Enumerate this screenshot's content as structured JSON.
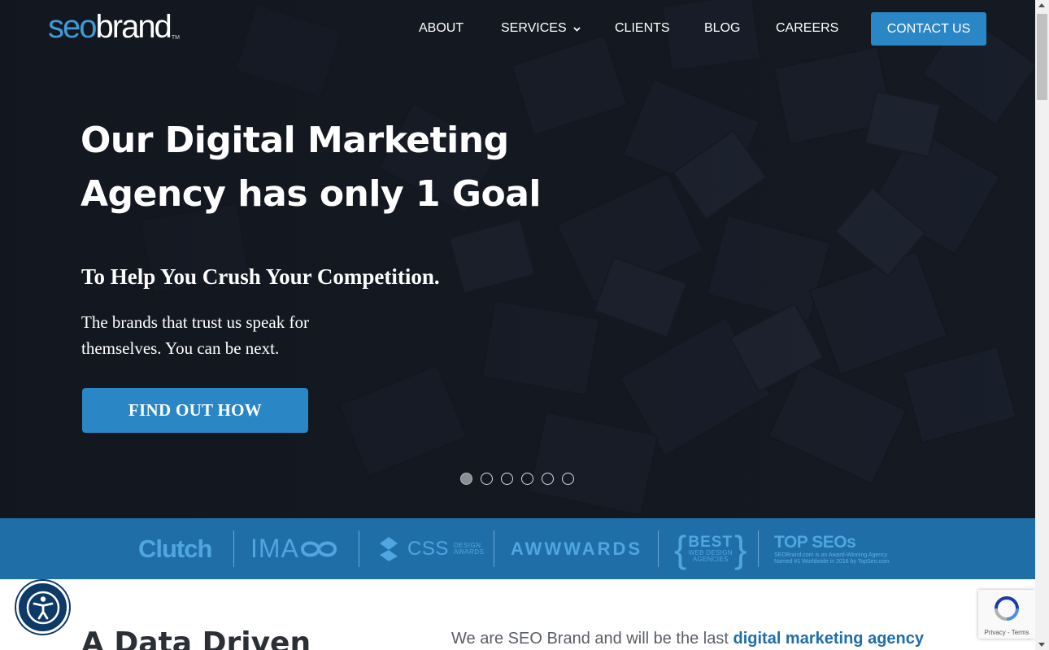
{
  "logo": {
    "part1": "seo",
    "part2": "brand",
    "tm": "TM"
  },
  "nav": {
    "items": [
      "ABOUT",
      "SERVICES",
      "CLIENTS",
      "BLOG",
      "CAREERS"
    ],
    "contact": "CONTACT US"
  },
  "hero": {
    "title": "Our Digital Marketing Agency has only 1 Goal",
    "subtitle": "To Help You Crush Your Competition.",
    "description": "The brands that trust us speak for themselves. You can be next.",
    "cta": "FIND OUT HOW",
    "slides": 6,
    "active_slide": 1
  },
  "awards": {
    "clutch": "Clutch",
    "ima": "IMA",
    "css_big": "CSS",
    "css_small_1": "DESIGN",
    "css_small_2": "AWARDS",
    "awwwards": "AWWWARDS",
    "best_big": "BEST",
    "best_small_1": "WEB DESIGN",
    "best_small_2": "AGENCIES",
    "topseos": "TOP SEOs",
    "topseos_note_1": "SEOBrand.com is an Award-Winning Agency",
    "topseos_note_2": "Named #1 Worldwide in 2016 by TopSeo.com"
  },
  "below": {
    "heading": "A Data Driven",
    "text_prefix": "We are SEO Brand and will be the last ",
    "text_link": "digital marketing agency"
  },
  "recaptcha": {
    "privacy": "Privacy",
    "terms": "Terms"
  },
  "colors": {
    "accent": "#2b86c6",
    "awards_bg": "#1f6ea8",
    "hero_bg": "#161b24",
    "logo_seo": "#3e9bd8"
  },
  "icons": {
    "accessibility": "accessibility-icon",
    "services_dropdown": "chevron-down-icon",
    "recaptcha": "recaptcha-icon"
  }
}
